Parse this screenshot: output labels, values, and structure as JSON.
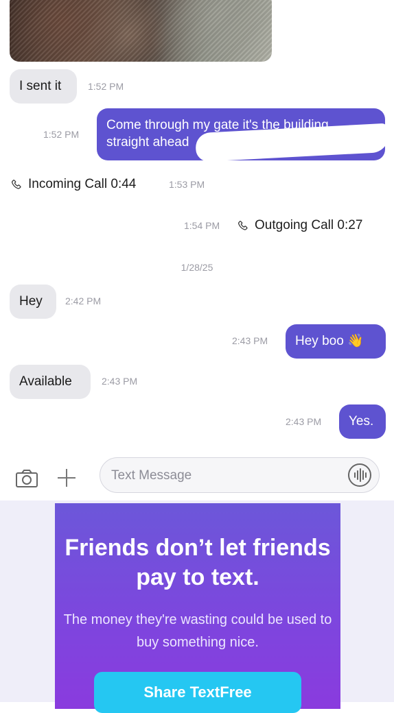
{
  "conversation": {
    "photo_message": {
      "kind": "image"
    },
    "messages": [
      {
        "side": "incoming",
        "text": "I sent it",
        "time": "1:52 PM"
      },
      {
        "side": "outgoing",
        "text": "Come through my gate it's the building straight ahead",
        "time": "1:52 PM"
      },
      {
        "side": "call",
        "direction": "incoming",
        "text": "Incoming Call 0:44",
        "time": "1:53 PM"
      },
      {
        "side": "call",
        "direction": "outgoing",
        "text": "Outgoing Call 0:27",
        "time": "1:54 PM"
      },
      {
        "side": "incoming",
        "text": "Hey",
        "time": "2:42 PM"
      },
      {
        "side": "outgoing",
        "text": "Hey boo 👋",
        "time": "2:43 PM"
      },
      {
        "side": "incoming",
        "text": "Available",
        "time": "2:43 PM"
      },
      {
        "side": "outgoing",
        "text": "Yes.",
        "time": "2:43 PM"
      }
    ],
    "date_separator": "1/28/25"
  },
  "composer": {
    "placeholder": "Text Message",
    "icons": [
      "camera-icon",
      "plus-icon",
      "voice-icon"
    ]
  },
  "ad": {
    "headline": "Friends don’t let friends pay to text.",
    "body": "The money they're wasting could be used to buy something nice.",
    "button_label": "Share TextFree",
    "colors": {
      "card_top": "#6c57d9",
      "card_bottom": "#8a3bde",
      "button": "#25c7f2"
    }
  },
  "colors": {
    "outgoing_bubble": "#5e53d0",
    "incoming_bubble": "#e8e8ec",
    "timestamp": "#9b9ba4"
  }
}
